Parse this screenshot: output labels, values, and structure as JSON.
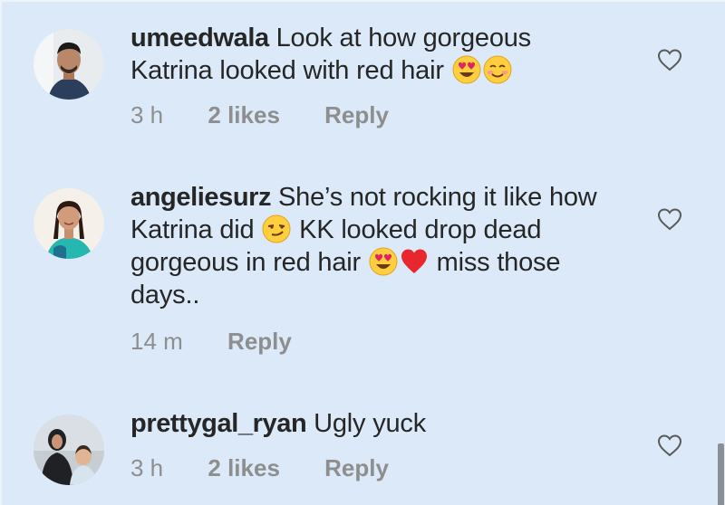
{
  "comments": [
    {
      "username": "umeedwala",
      "text_parts": [
        "Look at how gorgeous Katrina looked with red hair"
      ],
      "time": "3 h",
      "likes": "2 likes",
      "reply": "Reply",
      "avatar_icon": "man-portrait-avatar",
      "emojis": [
        "heart-eyes-emoji",
        "smiling-blush-emoji"
      ]
    },
    {
      "username": "angeliesurz",
      "text_parts": [
        "She’s not rocking it like how Katrina did",
        "KK looked drop dead gorgeous in red hair",
        "miss those days.."
      ],
      "time": "14 m",
      "reply": "Reply",
      "avatar_icon": "woman-portrait-avatar",
      "emojis": [
        "smirk-emoji",
        "heart-eyes-emoji",
        "red-heart-emoji"
      ]
    },
    {
      "username": "prettygal_ryan",
      "text_parts": [
        "Ugly yuck"
      ],
      "time": "3 h",
      "likes": "2 likes",
      "reply": "Reply",
      "avatar_icon": "woman-with-child-avatar",
      "emojis": []
    }
  ],
  "colors": {
    "background": "#dbe9f9",
    "text": "#262626",
    "meta": "#8e8e8e"
  },
  "icons": {
    "like": "heart-outline-icon"
  }
}
